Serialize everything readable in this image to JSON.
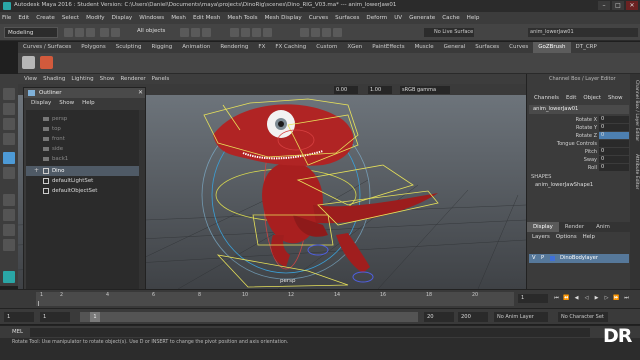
{
  "window": {
    "title": "Autodesk Maya 2016 : Student Version: C:\\Users\\Daniel\\Documents\\maya\\projects\\DinoRig\\scenes\\Dino_RIG_V03.ma* --- anim_lowerJaw01",
    "controls": [
      "–",
      "□",
      "✕"
    ]
  },
  "menubar": [
    "File",
    "Edit",
    "Create",
    "Select",
    "Modify",
    "Display",
    "Windows",
    "Mesh",
    "Edit Mesh",
    "Mesh Tools",
    "Mesh Display",
    "Curves",
    "Surfaces",
    "Deform",
    "UV",
    "Generate",
    "Cache",
    "Help"
  ],
  "statusline": {
    "mode": "Modeling",
    "objects_label": "All objects",
    "live_surface": "No Live Surface",
    "user_field": "anim_lowerJaw01"
  },
  "shelf_tabs": [
    "Curves / Surfaces",
    "Polygons",
    "Sculpting",
    "Rigging",
    "Animation",
    "Rendering",
    "FX",
    "FX Caching",
    "Custom",
    "XGen",
    "PaintEffects",
    "Muscle",
    "General",
    "Surfaces",
    "Curves",
    "GoZBrush",
    "DT_CRP"
  ],
  "shelf_active_tab": "GoZBrush",
  "panel_menu": [
    "View",
    "Shading",
    "Lighting",
    "Show",
    "Renderer",
    "Panels"
  ],
  "viewport_toolbar": {
    "value_a": "0.00",
    "value_b": "1.00",
    "colorspace": "sRGB gamma"
  },
  "viewport": {
    "camera_label": "persp"
  },
  "outliner": {
    "title": "Outliner",
    "menu": [
      "Display",
      "Show",
      "Help"
    ],
    "items": [
      {
        "label": "persp",
        "kind": "camera",
        "bright": false,
        "selected": false
      },
      {
        "label": "top",
        "kind": "camera",
        "bright": false,
        "selected": false
      },
      {
        "label": "front",
        "kind": "camera",
        "bright": false,
        "selected": false
      },
      {
        "label": "side",
        "kind": "camera",
        "bright": false,
        "selected": false
      },
      {
        "label": "back1",
        "kind": "camera",
        "bright": false,
        "selected": false
      },
      {
        "label": "Dino",
        "kind": "group",
        "bright": true,
        "selected": true
      },
      {
        "label": "defaultLightSet",
        "kind": "set",
        "bright": true,
        "selected": false
      },
      {
        "label": "defaultObjectSet",
        "kind": "set",
        "bright": true,
        "selected": false
      }
    ]
  },
  "channel_box": {
    "header": "Channel Box / Layer Editor",
    "menu": [
      "Channels",
      "Edit",
      "Object",
      "Show"
    ],
    "object_name": "anim_lowerJaw01",
    "attributes": [
      {
        "label": "Rotate X",
        "value": "0"
      },
      {
        "label": "Rotate Y",
        "value": "0"
      },
      {
        "label": "Rotate Z",
        "value": "0",
        "highlight": true
      },
      {
        "label": "Tongue Controls",
        "value": ""
      },
      {
        "label": "Pitch",
        "value": "0"
      },
      {
        "label": "Sway",
        "value": "0"
      },
      {
        "label": "Roll",
        "value": "0"
      }
    ],
    "shapes_label": "SHAPES",
    "shape_name": "anim_lowerJawShape1"
  },
  "layer_editor": {
    "tabs": [
      "Display",
      "Render",
      "Anim"
    ],
    "active_tab": "Display",
    "menu": [
      "Layers",
      "Options",
      "Help"
    ],
    "layer": {
      "v": "V",
      "p": "P",
      "name": "DinoBodylayer"
    }
  },
  "side_tabs": [
    "Channel Box / Layer Editor",
    "Attribute Editor"
  ],
  "timeslider": {
    "ticks": [
      "1",
      "2",
      "4",
      "6",
      "8",
      "10",
      "12",
      "14",
      "16",
      "18",
      "20"
    ],
    "current_frame": "1"
  },
  "rangeslider": {
    "start": "1",
    "inner_start": "1",
    "range_start": "1",
    "range_end": "20",
    "end": "20",
    "end_total": "200",
    "anim_layer": "No Anim Layer",
    "character_set": "No Character Set"
  },
  "cmdline": {
    "label": "MEL"
  },
  "helpline": {
    "text": "Rotate Tool: Use manipulator to rotate object(s). Use D or INSERT to change the pivot position and axis orientation."
  },
  "watermark": "DR",
  "colors": {
    "accent": "#4d9ad6",
    "dino_red": "#a81f1f",
    "selection_yellow": "#e8e25a",
    "layer_blue": "#56789a"
  }
}
